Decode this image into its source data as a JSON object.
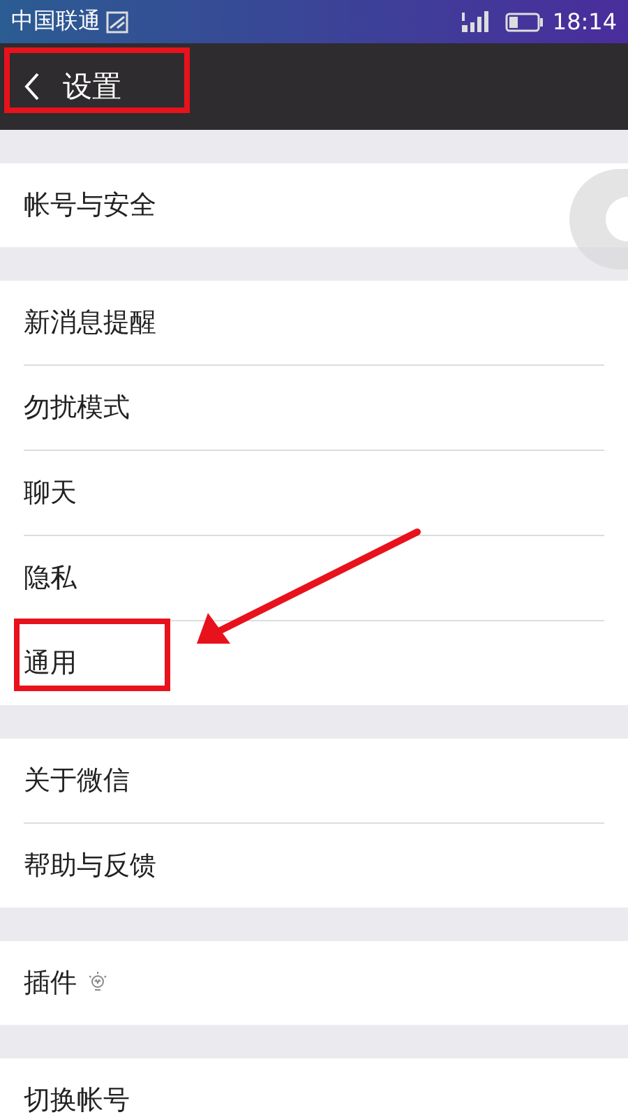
{
  "status_bar": {
    "carrier": "中国联通",
    "time": "18:14"
  },
  "header": {
    "title": "设置",
    "highlighted": true
  },
  "groups": [
    {
      "items": [
        {
          "label": "帐号与安全",
          "kind": "plain",
          "highlighted": false
        }
      ]
    },
    {
      "items": [
        {
          "label": "新消息提醒",
          "kind": "plain",
          "highlighted": false
        },
        {
          "label": "勿扰模式",
          "kind": "plain",
          "highlighted": false
        },
        {
          "label": "聊天",
          "kind": "plain",
          "highlighted": false
        },
        {
          "label": "隐私",
          "kind": "plain",
          "highlighted": false
        },
        {
          "label": "通用",
          "kind": "plain",
          "highlighted": true
        }
      ]
    },
    {
      "items": [
        {
          "label": "关于微信",
          "kind": "plain",
          "highlighted": false
        },
        {
          "label": "帮助与反馈",
          "kind": "plain",
          "highlighted": false
        }
      ]
    },
    {
      "items": [
        {
          "label": "插件",
          "kind": "bulb",
          "highlighted": false
        }
      ]
    },
    {
      "items": [
        {
          "label": "切换帐号",
          "kind": "plain",
          "highlighted": false
        }
      ]
    }
  ]
}
